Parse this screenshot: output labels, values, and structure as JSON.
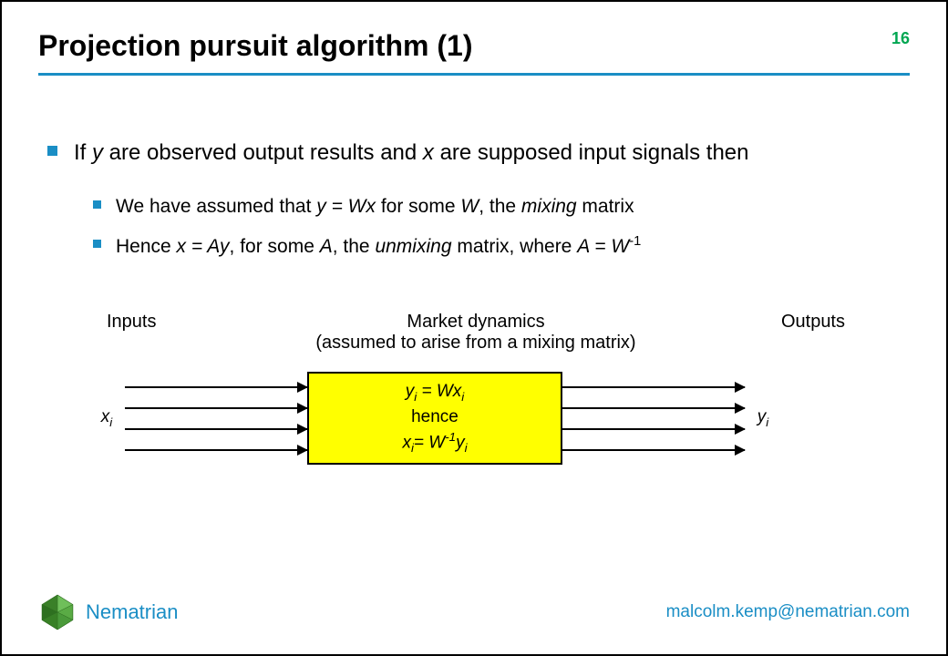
{
  "slide": {
    "title": "Projection pursuit algorithm (1)",
    "number": "16"
  },
  "bullets": {
    "b1": {
      "pre": "If ",
      "y": "y",
      "mid1": " are observed output results and ",
      "x": "x",
      "tail": " are supposed input signals then"
    },
    "b2": {
      "pre": "We have assumed that ",
      "eq": "y = Wx",
      "mid": " for some ",
      "W": "W",
      "mid2": ", the ",
      "mix": "mixing",
      "tail": " matrix"
    },
    "b3": {
      "pre": "Hence ",
      "eq": "x = Ay",
      "mid": ", for some ",
      "A": "A",
      "mid2": ", the ",
      "unmix": "unmixing",
      "mid3": " matrix, where ",
      "eq2_lhs": "A = W",
      "sup": "-1"
    }
  },
  "diagram": {
    "inputs_label": "Inputs",
    "mid_label_line1": "Market dynamics",
    "mid_label_line2": "(assumed to arise from a mixing matrix)",
    "outputs_label": "Outputs",
    "x_var": "x",
    "x_sub": "i",
    "y_var": "y",
    "y_sub": "i",
    "box_line1_lhs_y": "y",
    "box_line1_lhs_sub": "i",
    "box_line1_eq": " = Wx",
    "box_line1_rhs_sub": "i",
    "box_line2": "hence",
    "box_line3_lhs_x": "x",
    "box_line3_lhs_sub": "i",
    "box_line3_eq": "= W",
    "box_line3_sup": "-1",
    "box_line3_rhs_y": "y",
    "box_line3_rhs_sub": "i"
  },
  "footer": {
    "brand": "Nematrian",
    "email": "malcolm.kemp@nematrian.com"
  }
}
